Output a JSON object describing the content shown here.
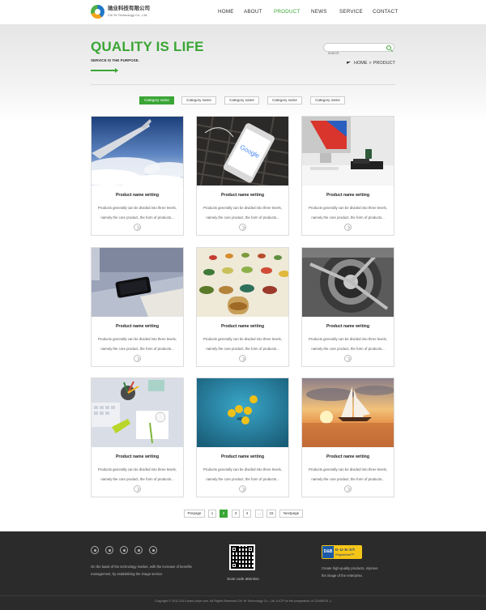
{
  "brand": {
    "name_cn": "驰业科技有限公司",
    "name_en": "Chi Ye Technology Co., Ltd."
  },
  "nav": [
    "HOME",
    "ABOUT",
    "PRODUCT",
    "NEWS",
    "SERVICE",
    "CONTACT"
  ],
  "nav_active": "PRODUCT",
  "banner": {
    "title": "QUALITY IS LIFE",
    "subtitle": "SERVICE IS THE PURPOSE.",
    "search_placeholder": "search",
    "breadcrumb_home": "HOME",
    "breadcrumb_sep": ">",
    "breadcrumb_current": "PRODUCT"
  },
  "categories": [
    "Category name",
    "Category name",
    "Category name",
    "Category name",
    "Category name"
  ],
  "products": [
    {
      "title": "Product name writing",
      "desc_1": "Products generally can be divided into three levels,",
      "desc_2": "namely the core product, the form of products..."
    },
    {
      "title": "Product name writing",
      "desc_1": "Products generally can be divided into three levels,",
      "desc_2": "namely the core product, the form of products..."
    },
    {
      "title": "Product name writing",
      "desc_1": "Products generally can be divided into three levels,",
      "desc_2": "namely the core product, the form of products..."
    },
    {
      "title": "Product name writing",
      "desc_1": "Products generally can be divided into three levels,",
      "desc_2": "namely the core product, the form of products..."
    },
    {
      "title": "Product name writing",
      "desc_1": "Products generally can be divided into three levels,",
      "desc_2": "namely the core product, the form of products..."
    },
    {
      "title": "Product name writing",
      "desc_1": "Products generally can be divided into three levels,",
      "desc_2": "namely the core product, the form of products..."
    },
    {
      "title": "Product name writing",
      "desc_1": "Products generally can be divided into three levels,",
      "desc_2": "namely the core product, the form of products..."
    },
    {
      "title": "Product name writing",
      "desc_1": "Products generally can be divided into three levels,",
      "desc_2": "namely the core product, the form of products..."
    },
    {
      "title": "Product name writing",
      "desc_1": "Products generally can be divided into three levels,",
      "desc_2": "namely the core product, the form of products..."
    }
  ],
  "product_images": [
    "airplane-wing-clouds",
    "google-phone",
    "desktop-computer",
    "black-smartphone",
    "test-tubes",
    "aircraft-propeller",
    "desk-stationery",
    "yellow-balls-blue",
    "sailboat-sunset"
  ],
  "pagination": {
    "prev": "Prepage",
    "pages": [
      "1",
      "2",
      "3",
      "4",
      "...",
      "15"
    ],
    "current": "2",
    "next": "Nextpage"
  },
  "footer": {
    "social_icons": [
      "home-icon",
      "weibo-icon",
      "facebook-icon",
      "chat-icon",
      "location-icon"
    ],
    "left_text_1": "On the basis of the technology market, with the increase of benefits",
    "left_text_2": "management, by establishing the image service",
    "qr_caption": "Scan code attention",
    "duns_db": "D&B",
    "duns_line1": "D-U-N-S®",
    "duns_line2": "Registered™",
    "right_text_1": "Create high-quality products, improve",
    "right_text_2": "the image of the enterprise.",
    "copyright": "Copyright © 2011-2014 www.chiye.com. All Rights Reserved  Chi Ye Technology Co., Ltd. A ICP for the preparation of 12345678 -1"
  },
  "colors": {
    "accent": "#3aa535",
    "footer_bg": "#2b2b2b"
  }
}
